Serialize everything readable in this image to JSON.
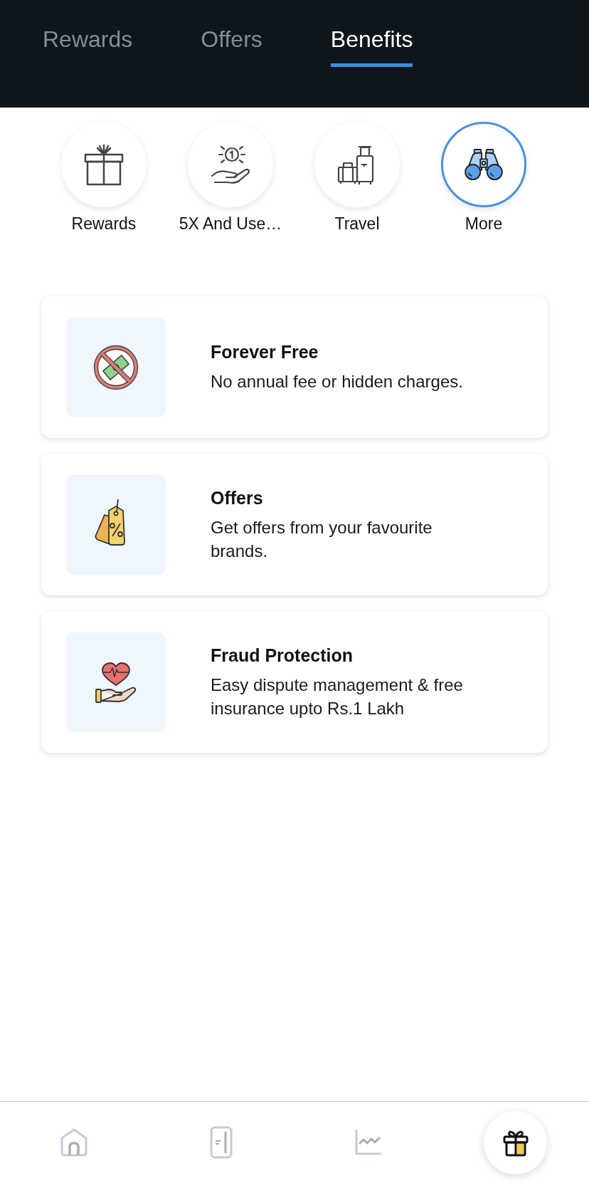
{
  "tabs": [
    {
      "label": "Rewards",
      "selected": false
    },
    {
      "label": "Offers",
      "selected": false
    },
    {
      "label": "Benefits",
      "selected": true
    }
  ],
  "categories": [
    {
      "kind": "gift",
      "label": "Rewards",
      "selected": false
    },
    {
      "kind": "coin-hand",
      "label": "5X And Use…",
      "selected": false
    },
    {
      "kind": "luggage",
      "label": "Travel",
      "selected": false
    },
    {
      "kind": "binoculars",
      "label": "More",
      "selected": true
    }
  ],
  "benefits": [
    {
      "kind": "no-fee",
      "title": "Forever Free",
      "description": "No annual fee or hidden charges."
    },
    {
      "kind": "tag",
      "title": "Offers",
      "description": "Get offers from your favourite brands."
    },
    {
      "kind": "heart-hand",
      "title": "Fraud Protection",
      "description": "Easy dispute management & free insurance upto Rs.1 Lakh"
    }
  ],
  "bottom_nav": [
    {
      "kind": "home",
      "selected": false
    },
    {
      "kind": "card",
      "selected": false
    },
    {
      "kind": "chart",
      "selected": false
    },
    {
      "kind": "gift",
      "selected": true
    }
  ]
}
